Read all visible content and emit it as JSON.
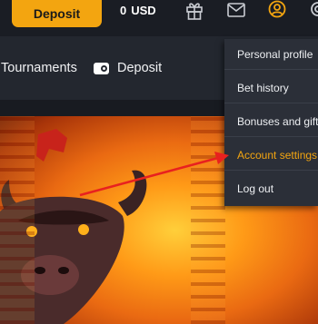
{
  "header": {
    "deposit_label": "Deposit",
    "balance_amount": "0",
    "balance_currency": "USD",
    "icons": [
      "gift-icon",
      "mail-icon",
      "user-icon",
      "gear-icon"
    ]
  },
  "nav": {
    "tournaments_label": "Tournaments",
    "deposit_label": "Deposit"
  },
  "profile_menu": {
    "items": [
      {
        "label": "Personal profile"
      },
      {
        "label": "Bet history"
      },
      {
        "label": "Bonuses and gifts"
      },
      {
        "label": "Account settings",
        "highlighted": true
      },
      {
        "label": "Log out"
      }
    ]
  },
  "colors": {
    "accent": "#f3a510",
    "annotation_arrow": "#e8211f",
    "topbar_bg": "#1a1d24",
    "menu_bg": "#2b2f38"
  }
}
